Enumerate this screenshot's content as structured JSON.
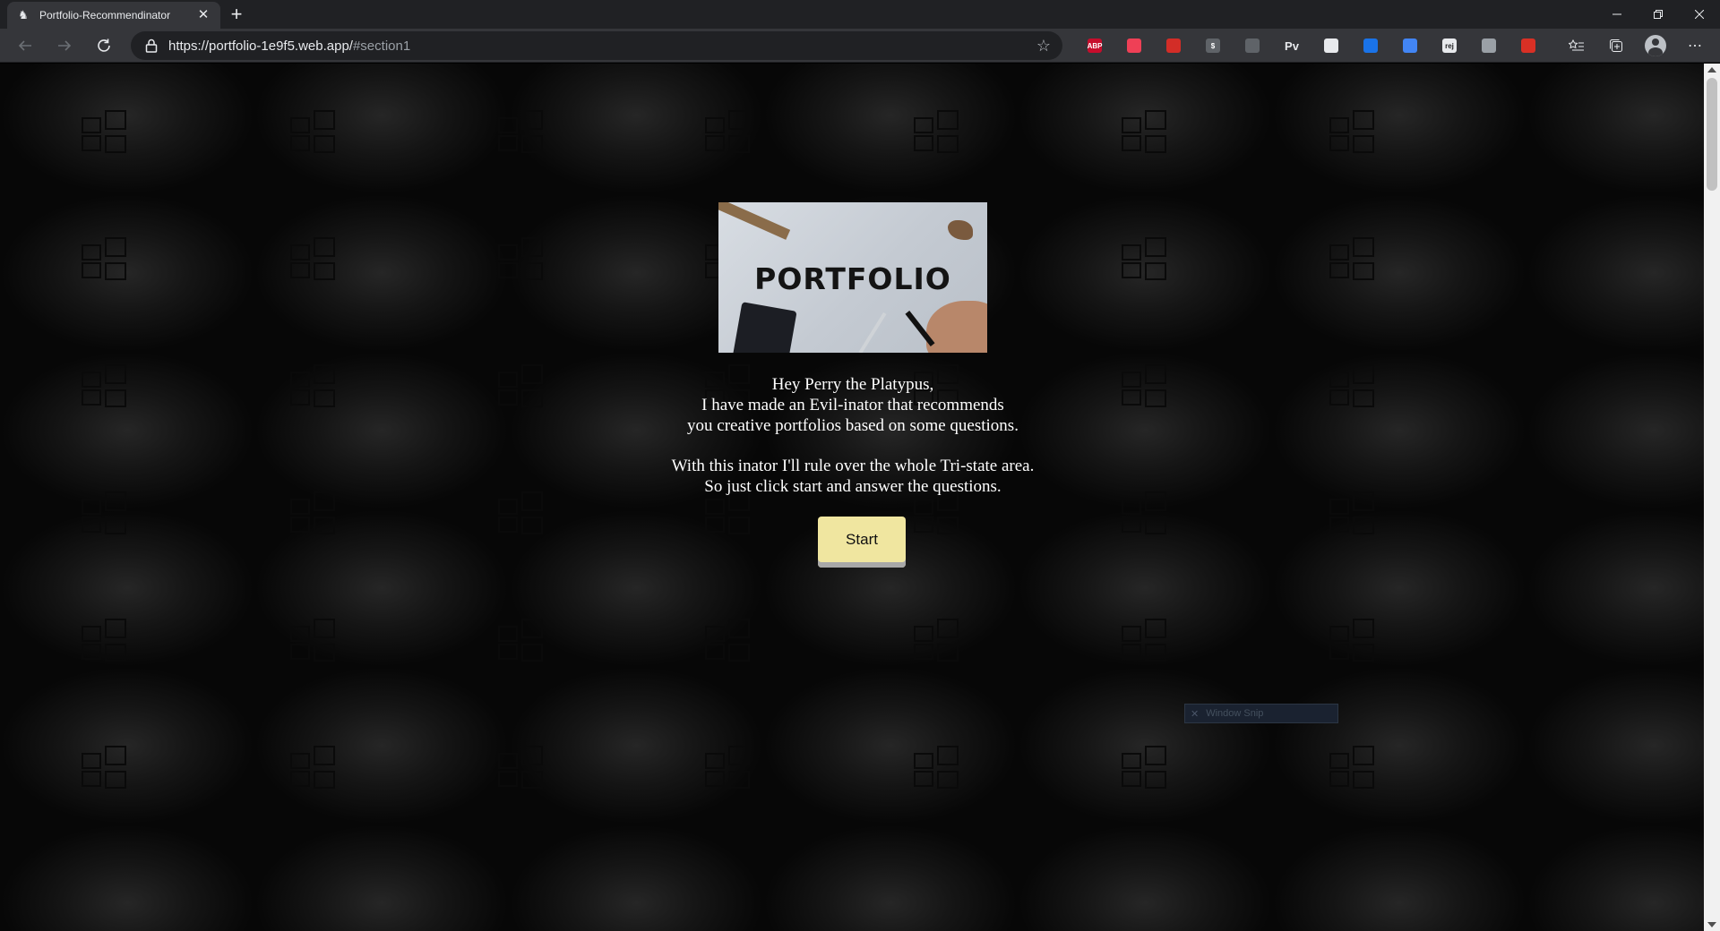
{
  "browser": {
    "tab_title": "Portfolio-Recommendinator",
    "tab_close": "✕",
    "new_tab": "+",
    "url_base": "https://portfolio-1e9f5.web.app/",
    "url_hash": "#section1",
    "extensions": [
      {
        "name": "adblock-plus-icon",
        "label": "ABP",
        "color": "#c70d2c"
      },
      {
        "name": "pocket-icon",
        "label": "",
        "color": "#ef4056"
      },
      {
        "name": "lastpass-icon",
        "label": "",
        "color": "#d32d27"
      },
      {
        "name": "dollar-icon",
        "label": "$",
        "color": "#5f6368"
      },
      {
        "name": "gamepad-icon",
        "label": "",
        "color": "#5f6368"
      },
      {
        "name": "pv-icon",
        "label": "Pv",
        "color": ""
      },
      {
        "name": "play-icon",
        "label": "",
        "color": "#e8eaed"
      },
      {
        "name": "globe-icon",
        "label": "",
        "color": "#1a73e8"
      },
      {
        "name": "pencil-icon",
        "label": "",
        "color": "#4285f4"
      },
      {
        "name": "regex-icon",
        "label": "rej",
        "color": "#e8eaed"
      },
      {
        "name": "compass-icon",
        "label": "",
        "color": "#9aa0a6"
      },
      {
        "name": "block-icon",
        "label": "",
        "color": "#d93025"
      }
    ]
  },
  "hero": {
    "word": "PORTFOLIO"
  },
  "intro": {
    "line1": "Hey Perry the Platypus,",
    "line2": "I have made an Evil-inator that recommends",
    "line3": "you creative portfolios based on some questions.",
    "line4": "With this inator I'll rule over the whole Tri-state area.",
    "line5": "So just click start and answer the questions."
  },
  "start_button": {
    "label": "Start",
    "color": "#f0e6a0"
  },
  "snip_overlay": {
    "close": "✕",
    "label": "Window Snip"
  }
}
